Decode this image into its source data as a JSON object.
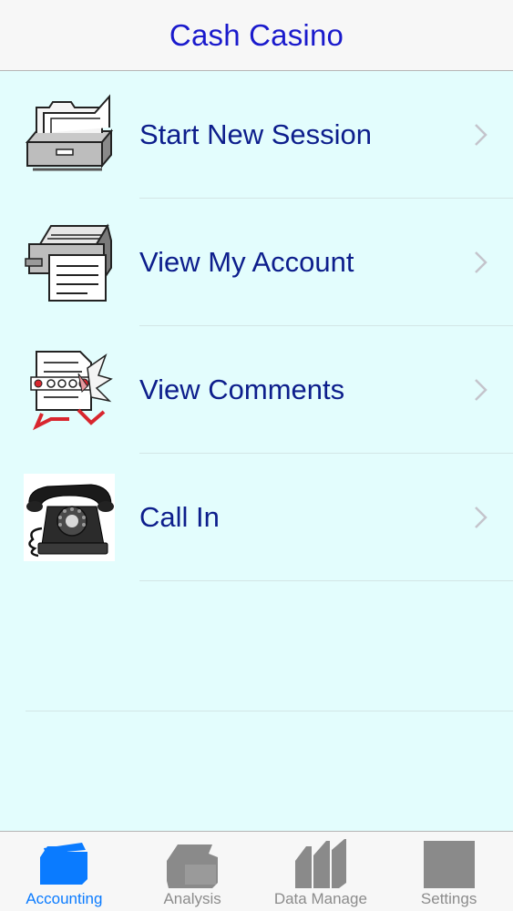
{
  "navbar": {
    "title": "Cash Casino"
  },
  "menu": {
    "items": [
      {
        "label": "Start New Session",
        "icon": "file-cabinet-icon"
      },
      {
        "label": "View My Account",
        "icon": "card-file-icon"
      },
      {
        "label": "View Comments",
        "icon": "notepad-icon"
      },
      {
        "label": "Call In",
        "icon": "rotary-phone-icon"
      }
    ]
  },
  "tabbar": {
    "tabs": [
      {
        "label": "Accounting",
        "icon": "accounting-icon",
        "active": true
      },
      {
        "label": "Analysis",
        "icon": "analysis-icon",
        "active": false
      },
      {
        "label": "Data Manage",
        "icon": "data-manage-icon",
        "active": false
      },
      {
        "label": "Settings",
        "icon": "settings-icon",
        "active": false
      }
    ]
  },
  "colors": {
    "background": "#e3fdfd",
    "title": "#1a1acc",
    "label": "#0d1e8c",
    "tab_active": "#0a7bff",
    "tab_inactive": "#8c8c8c"
  }
}
